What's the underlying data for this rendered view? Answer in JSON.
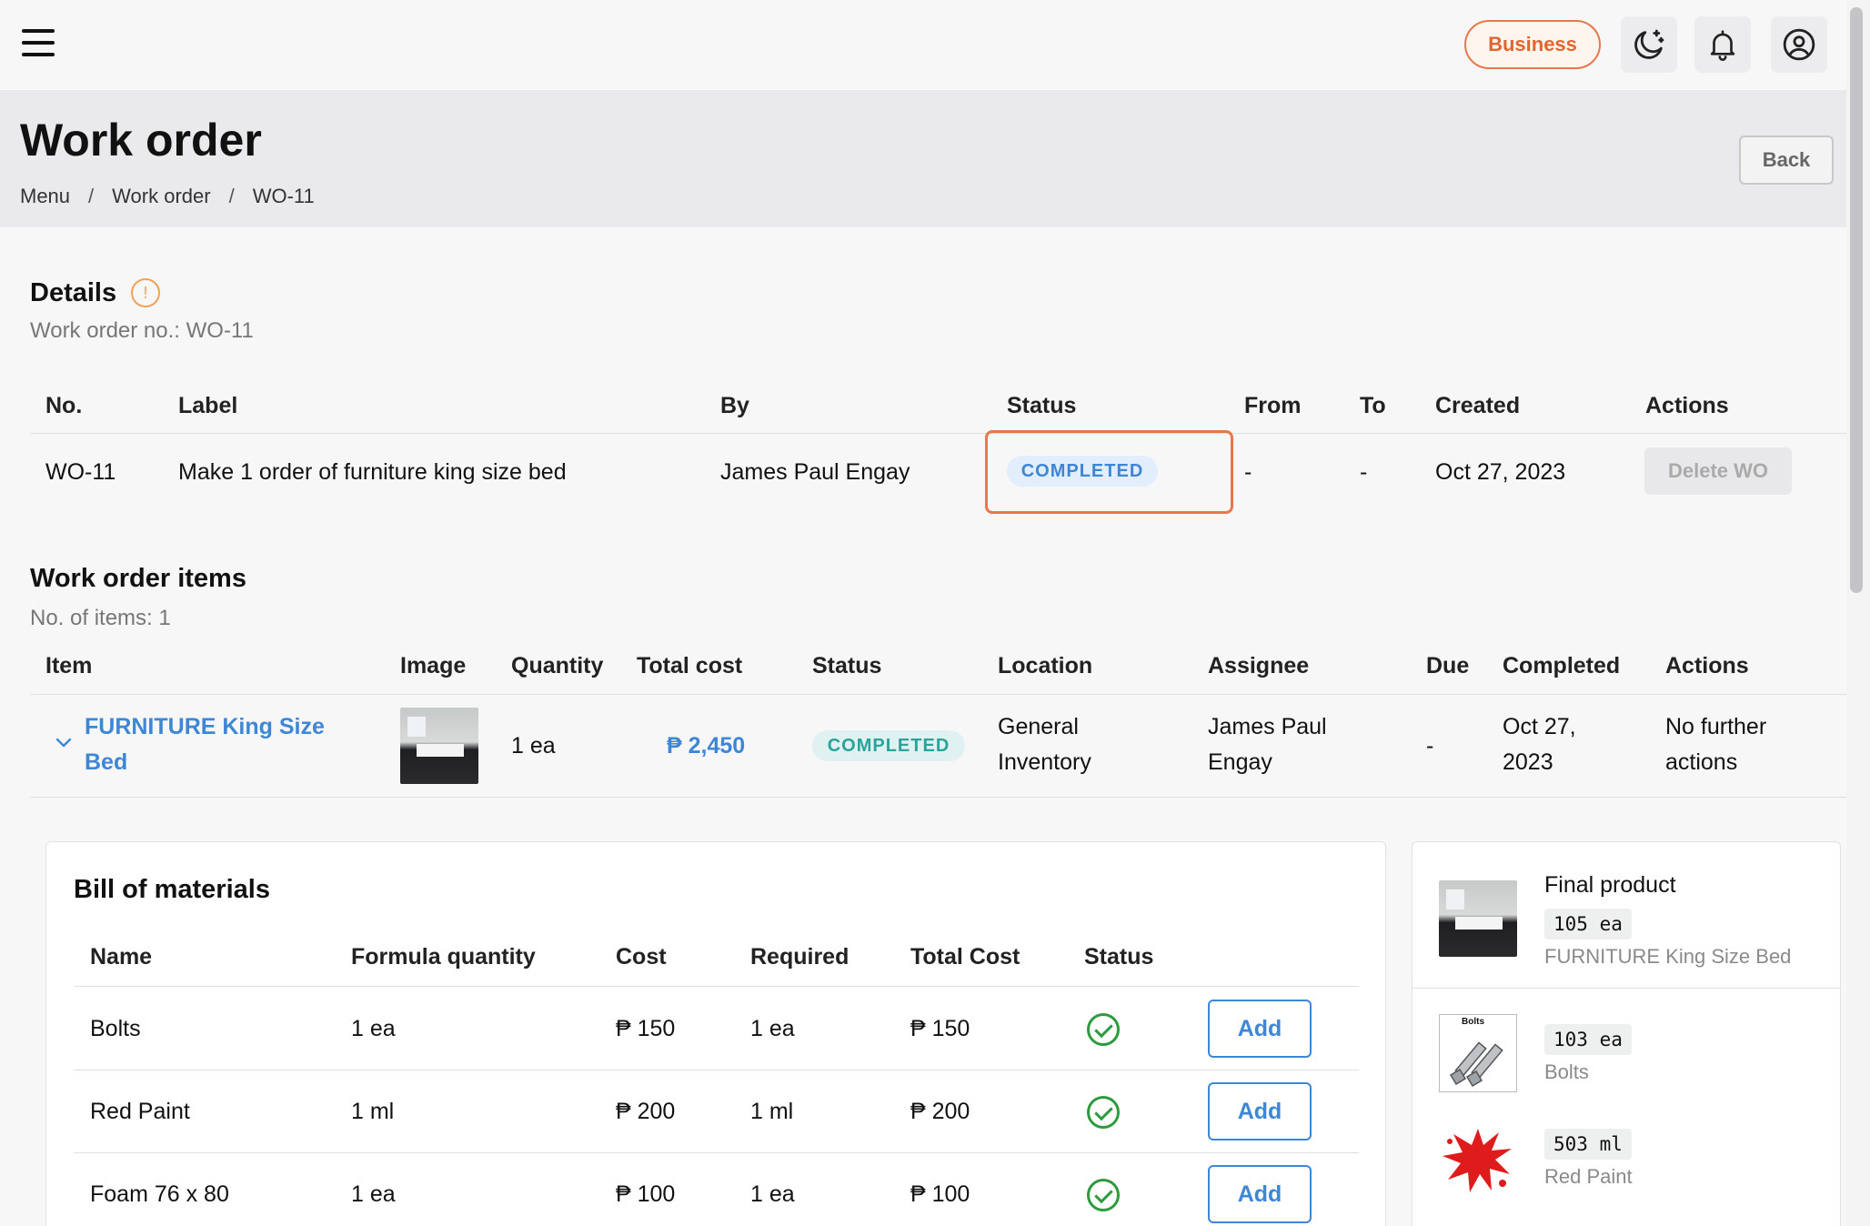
{
  "topbar": {
    "business_label": "Business"
  },
  "header": {
    "title": "Work order",
    "breadcrumb": [
      "Menu",
      "Work order",
      "WO-11"
    ],
    "back_label": "Back"
  },
  "details": {
    "title": "Details",
    "info_glyph": "!",
    "subtitle": "Work order no.: WO-11",
    "columns": [
      "No.",
      "Label",
      "By",
      "Status",
      "From",
      "To",
      "Created",
      "Actions"
    ],
    "row": {
      "no": "WO-11",
      "label": "Make 1 order of furniture king size bed",
      "by": "James Paul Engay",
      "status": "COMPLETED",
      "from": "-",
      "to": "-",
      "created": "Oct 27, 2023",
      "action": "Delete WO"
    }
  },
  "items": {
    "title": "Work order items",
    "subtitle": "No. of items: 1",
    "columns": [
      "Item",
      "Image",
      "Quantity",
      "Total cost",
      "Status",
      "Location",
      "Assignee",
      "Due",
      "Completed",
      "Actions"
    ],
    "row": {
      "item_line1": "FURNITURE King Size",
      "item_line2": "Bed",
      "quantity": "1 ea",
      "total_cost": "₱ 2,450",
      "status": "COMPLETED",
      "location_line1": "General",
      "location_line2": "Inventory",
      "assignee_line1": "James Paul",
      "assignee_line2": "Engay",
      "due": "-",
      "completed_line1": "Oct 27,",
      "completed_line2": "2023",
      "actions_line1": "No further",
      "actions_line2": "actions"
    }
  },
  "bom": {
    "title": "Bill of materials",
    "columns": [
      "Name",
      "Formula quantity",
      "Cost",
      "Required",
      "Total Cost",
      "Status"
    ],
    "rows": [
      {
        "name": "Bolts",
        "formula_qty": "1 ea",
        "cost": "₱ 150",
        "required": "1 ea",
        "total": "₱ 150",
        "action": "Add"
      },
      {
        "name": "Red Paint",
        "formula_qty": "1 ml",
        "cost": "₱ 200",
        "required": "1 ml",
        "total": "₱ 200",
        "action": "Add"
      },
      {
        "name": "Foam 76 x 80",
        "formula_qty": "1 ea",
        "cost": "₱ 100",
        "required": "1 ea",
        "total": "₱ 100",
        "action": "Add"
      }
    ]
  },
  "inventory_panel": {
    "final_label": "Final product",
    "final_qty": "105 ea",
    "final_name": "FURNITURE King Size Bed",
    "materials": [
      {
        "qty": "103 ea",
        "name": "Bolts",
        "image_text": "Bolts"
      },
      {
        "qty": "503 ml",
        "name": "Red Paint"
      }
    ]
  },
  "colors": {
    "accent_orange": "#e8774a",
    "link_blue": "#3e86d6",
    "success_green": "#2e9a3e"
  }
}
